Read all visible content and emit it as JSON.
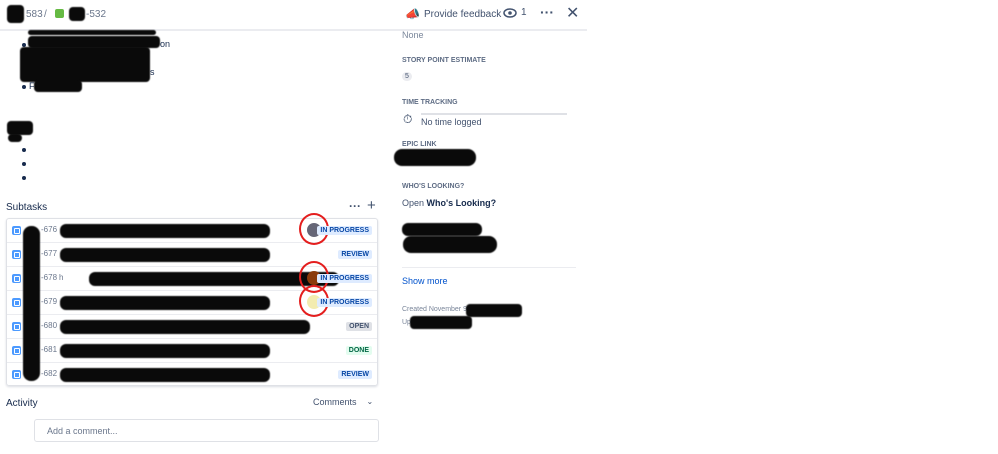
{
  "header": {
    "breadcrumb_parent": "583",
    "breadcrumb_sep": "/",
    "breadcrumb_current": "-532",
    "feedback_label": "Provide feedback",
    "watch_count": "1"
  },
  "description": {
    "partial_line_1": "on",
    "partial_line_2": "s",
    "partial_line_3": "F"
  },
  "subtasks": {
    "title": "Subtasks",
    "rows": [
      {
        "key": "-676",
        "status": "IN PROGRESS",
        "status_kind": "blue",
        "avatar": true
      },
      {
        "key": "-677",
        "status": "REVIEW",
        "status_kind": "blue",
        "avatar": false
      },
      {
        "key": "-678",
        "prefix": "h",
        "status": "IN PROGRESS",
        "status_kind": "blue",
        "avatar": true
      },
      {
        "key": "-679",
        "status": "IN PROGRESS",
        "status_kind": "blue",
        "avatar": true
      },
      {
        "key": "-680",
        "status": "OPEN",
        "status_kind": "grey",
        "avatar": false
      },
      {
        "key": "-681",
        "status": "DONE",
        "status_kind": "green",
        "avatar": false
      },
      {
        "key": "-682",
        "status": "REVIEW",
        "status_kind": "blue",
        "avatar": false
      }
    ]
  },
  "activity": {
    "title": "Activity",
    "filter_label": "Comments",
    "comment_placeholder": "Add a comment..."
  },
  "sidebar": {
    "none_value": "None",
    "story_points_label": "STORY POINT ESTIMATE",
    "story_points_value": "5",
    "time_tracking_label": "TIME TRACKING",
    "time_tracking_value": "No time logged",
    "epic_link_label": "EPIC LINK",
    "whos_looking_label": "WHO'S LOOKING?",
    "whos_looking_prefix": "Open",
    "whos_looking_link": "Who's Looking?",
    "show_more": "Show more",
    "created": "Created November 9",
    "updated_prefix": "Up"
  }
}
